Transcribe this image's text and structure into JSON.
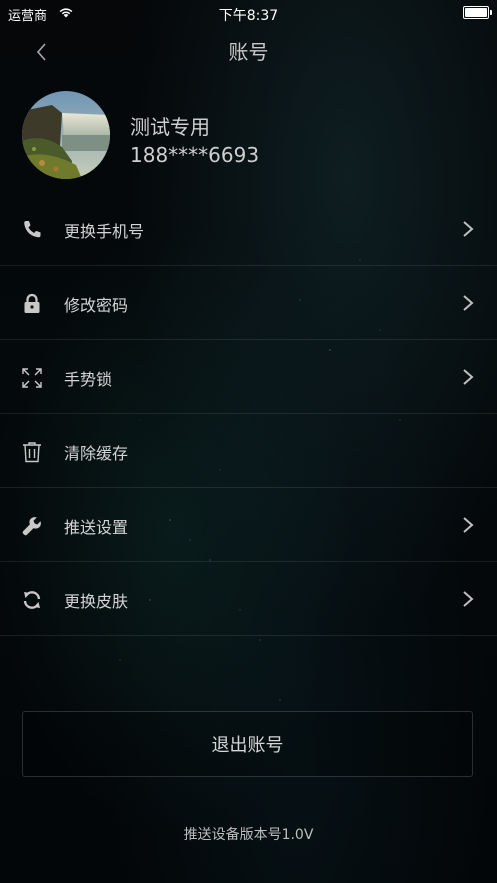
{
  "status_bar": {
    "carrier": "运营商",
    "time": "下午8:37",
    "wifi_icon": "wifi-icon",
    "battery_icon": "battery-full-icon"
  },
  "nav": {
    "title": "账号",
    "back_icon": "chevron-left-icon"
  },
  "profile": {
    "name": "测试专用",
    "phone": "188****6693"
  },
  "menu": {
    "items": [
      {
        "label": "更换手机号",
        "icon": "phone-icon",
        "has_arrow": true
      },
      {
        "label": "修改密码",
        "icon": "lock-icon",
        "has_arrow": true
      },
      {
        "label": "手势锁",
        "icon": "gesture-expand-icon",
        "has_arrow": true
      },
      {
        "label": "清除缓存",
        "icon": "trash-icon",
        "has_arrow": false
      },
      {
        "label": "推送设置",
        "icon": "wrench-icon",
        "has_arrow": true
      },
      {
        "label": "更换皮肤",
        "icon": "refresh-icon",
        "has_arrow": true
      }
    ]
  },
  "logout": {
    "label": "退出账号"
  },
  "footer": {
    "version": "推送设备版本号1.0V"
  },
  "colors": {
    "background": "#04080a",
    "text": "#d4d4d4",
    "divider": "#1c1f21"
  }
}
